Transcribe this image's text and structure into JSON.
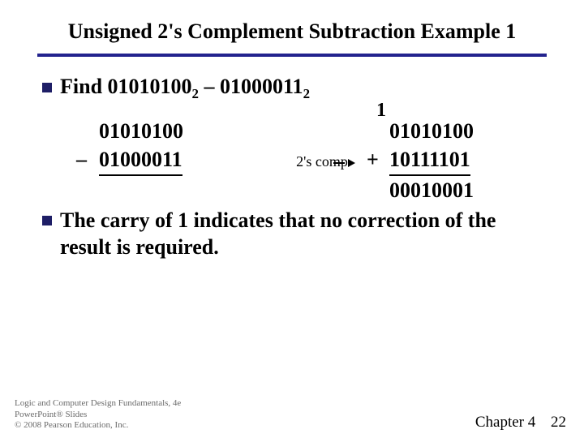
{
  "title": "Unsigned 2's Complement Subtraction Example 1",
  "find": {
    "label": "Find",
    "a": "01010100",
    "b": "01000011",
    "base": "2"
  },
  "work": {
    "minuend": "01010100",
    "subtrahend": "01000011",
    "annotation": "2's comp",
    "carry": "1",
    "addend_a": "01010100",
    "addend_b": "10111101",
    "result": "00010001",
    "minus_sign": "–",
    "plus_sign": "+"
  },
  "conclusion": "The carry of 1 indicates that no correction of the result is required.",
  "footer": {
    "line1": "Logic and Computer Design Fundamentals, 4e",
    "line2": "PowerPoint® Slides",
    "line3": "© 2008 Pearson Education, Inc.",
    "chapter": "Chapter 4",
    "page": "22"
  }
}
